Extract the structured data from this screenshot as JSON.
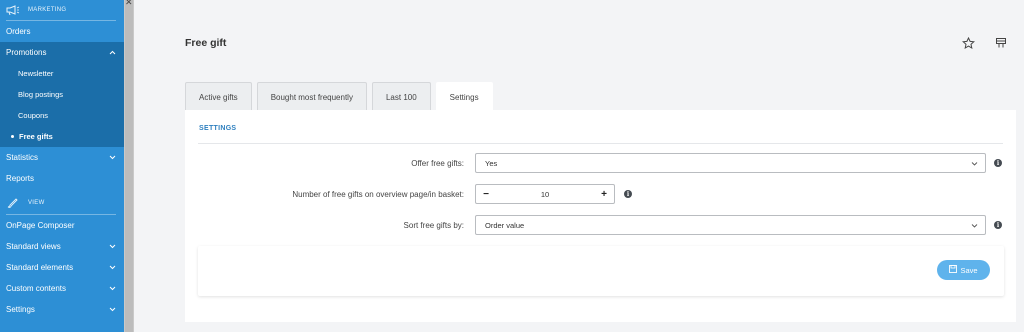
{
  "sidebar": {
    "marketing_section": "MARKETING",
    "view_section": "VIEW",
    "items_top": [
      {
        "label": "Orders"
      },
      {
        "label": "Promotions"
      }
    ],
    "promotions_sub": [
      {
        "label": "Newsletter"
      },
      {
        "label": "Blog postings"
      },
      {
        "label": "Coupons"
      },
      {
        "label": "Free gifts"
      }
    ],
    "items_mid": [
      {
        "label": "Statistics"
      },
      {
        "label": "Reports"
      }
    ],
    "items_view": [
      {
        "label": "OnPage Composer"
      },
      {
        "label": "Standard views"
      },
      {
        "label": "Standard elements"
      },
      {
        "label": "Custom contents"
      },
      {
        "label": "Settings"
      }
    ]
  },
  "header": {
    "title": "Free gift"
  },
  "tabs": [
    {
      "label": "Active gifts"
    },
    {
      "label": "Bought most frequently"
    },
    {
      "label": "Last 100"
    },
    {
      "label": "Settings"
    }
  ],
  "settings": {
    "heading": "SETTINGS",
    "offer_label": "Offer free gifts:",
    "offer_value": "Yes",
    "count_label": "Number of free gifts on overview page/in basket:",
    "count_value": "10",
    "sort_label": "Sort free gifts by:",
    "sort_value": "Order value",
    "save_label": "Save",
    "info_glyph": "i",
    "minus_glyph": "−",
    "plus_glyph": "+"
  },
  "colors": {
    "sidebar_bg": "#2d8fd5",
    "sidebar_group_bg": "#1b6ea9",
    "accent": "#2d7fbf",
    "save_button": "#5fb3ec"
  }
}
